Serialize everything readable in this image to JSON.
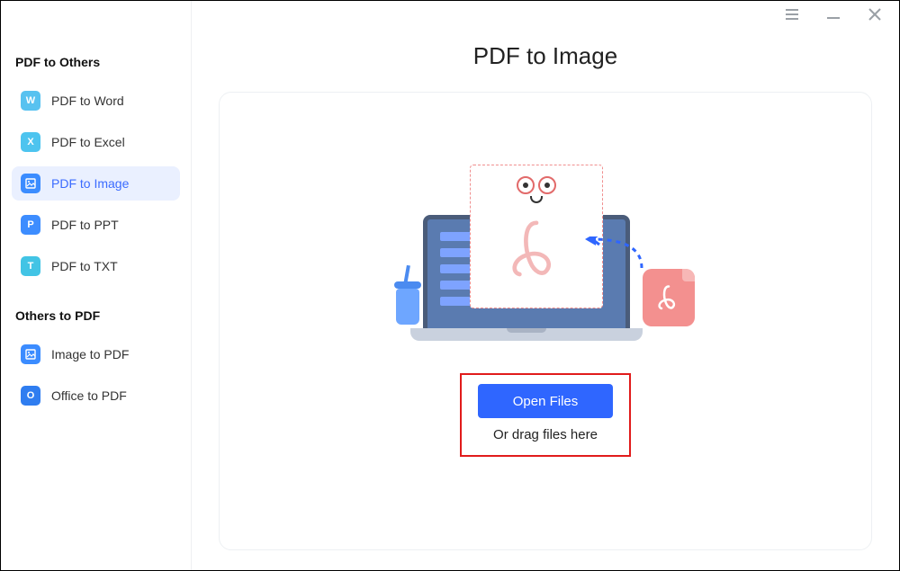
{
  "window": {
    "menu_icon": "menu",
    "minimize_icon": "minimize",
    "close_icon": "close"
  },
  "sidebar": {
    "group1_title": "PDF to Others",
    "group2_title": "Others to PDF",
    "items_group1": [
      {
        "label": "PDF to Word",
        "icon_letter": "W",
        "active": false
      },
      {
        "label": "PDF to Excel",
        "icon_letter": "X",
        "active": false
      },
      {
        "label": "PDF to Image",
        "icon_letter": "",
        "active": true
      },
      {
        "label": "PDF to PPT",
        "icon_letter": "P",
        "active": false
      },
      {
        "label": "PDF to TXT",
        "icon_letter": "T",
        "active": false
      }
    ],
    "items_group2": [
      {
        "label": "Image to PDF",
        "icon_letter": "",
        "active": false
      },
      {
        "label": "Office to PDF",
        "icon_letter": "O",
        "active": false
      }
    ]
  },
  "main": {
    "title": "PDF to Image",
    "open_button": "Open Files",
    "drag_hint": "Or drag files here"
  }
}
